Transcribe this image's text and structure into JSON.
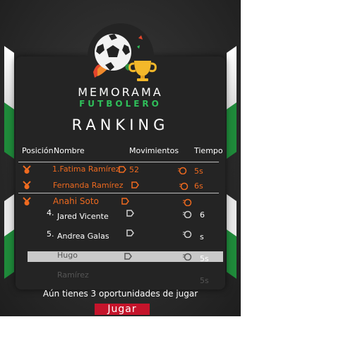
{
  "brand": {
    "line1": "MEMORAMA",
    "line2": "FUTBOLERO"
  },
  "screen_title": "RANKING",
  "table": {
    "headers": [
      "Posición",
      "Nombre",
      "Movimientos",
      "Tiempo"
    ],
    "rows": [
      {
        "name": "1.Fatima Ramírez",
        "moves": "52",
        "time": "5s"
      },
      {
        "name": "Fernanda Ramírez",
        "moves": "",
        "time": "6s"
      },
      {
        "name": "Anahi Soto",
        "moves": "",
        "time": ""
      },
      {
        "pos": "4.",
        "name": "Jared Vicente",
        "moves": "",
        "time": "6"
      },
      {
        "pos": "5.",
        "name": "Andrea  Galas",
        "moves": "",
        "time": "s"
      },
      {
        "name": "Hugo",
        "moves": "",
        "time": "5s"
      },
      {
        "name": "Ramírez",
        "moves": "",
        "time": "5s"
      }
    ]
  },
  "footer_text": "Aún tienes 3 oportunidades de jugar",
  "play_label": "Jugar",
  "colors": {
    "accent": "#ef6a1f",
    "green": "#2fbf5a",
    "button": "#c5142b",
    "card": "#242424"
  },
  "icons": [
    "soccer-ball-icon",
    "trophy-icon",
    "medal-icon",
    "moves-icon",
    "timer-icon"
  ]
}
